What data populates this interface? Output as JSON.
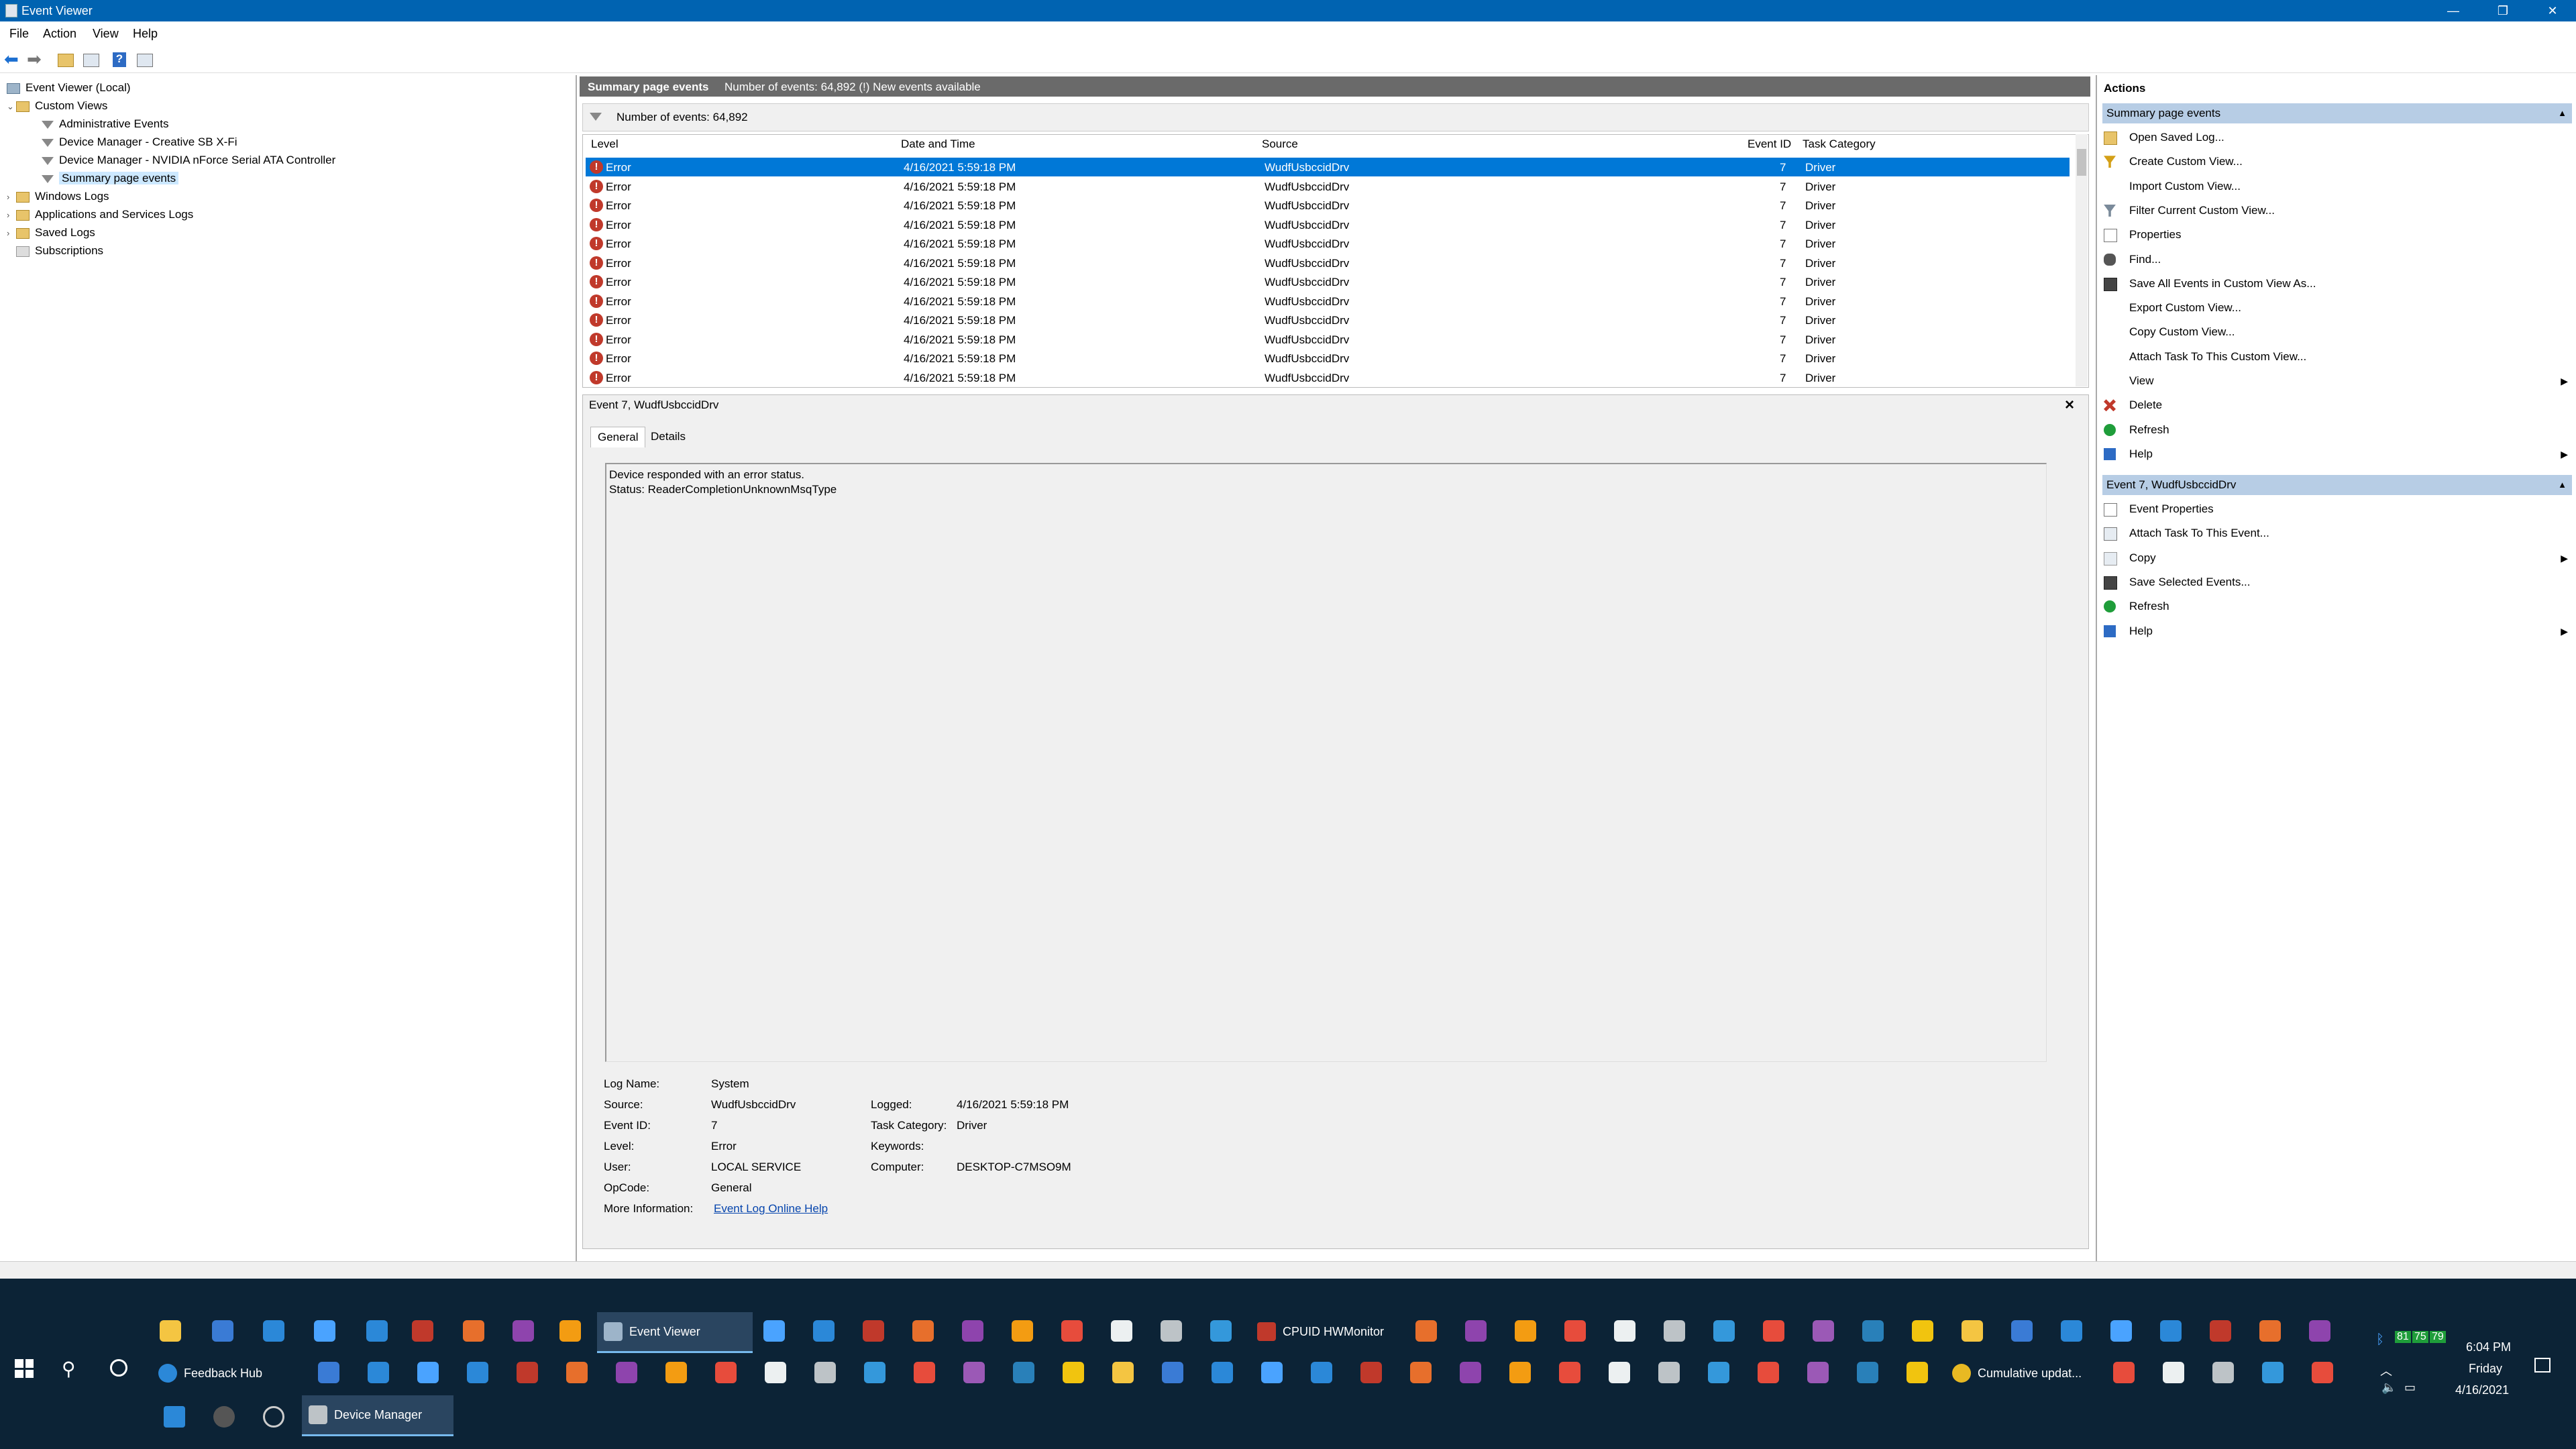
{
  "window": {
    "title": "Event Viewer",
    "minimize": "—",
    "restore": "❐",
    "close": "✕"
  },
  "menu": [
    "File",
    "Action",
    "View",
    "Help"
  ],
  "tree": {
    "root": "Event Viewer (Local)",
    "custom_views": "Custom Views",
    "custom_items": [
      "Administrative Events",
      "Device Manager - Creative SB X-Fi",
      "Device Manager - NVIDIA nForce Serial ATA Controller",
      "Summary page events"
    ],
    "windows_logs": "Windows Logs",
    "app_services": "Applications and Services Logs",
    "saved_logs": "Saved Logs",
    "subscriptions": "Subscriptions"
  },
  "middle": {
    "header_title": "Summary page events",
    "header_info": "Number of events: 64,892 (!) New events available",
    "count": "Number of events: 64,892",
    "columns": [
      "Level",
      "Date and Time",
      "Source",
      "Event ID",
      "Task Category"
    ],
    "rows": [
      {
        "level": "Error",
        "date": "4/16/2021 5:59:18 PM",
        "source": "WudfUsbccidDrv",
        "id": "7",
        "cat": "Driver"
      },
      {
        "level": "Error",
        "date": "4/16/2021 5:59:18 PM",
        "source": "WudfUsbccidDrv",
        "id": "7",
        "cat": "Driver"
      },
      {
        "level": "Error",
        "date": "4/16/2021 5:59:18 PM",
        "source": "WudfUsbccidDrv",
        "id": "7",
        "cat": "Driver"
      },
      {
        "level": "Error",
        "date": "4/16/2021 5:59:18 PM",
        "source": "WudfUsbccidDrv",
        "id": "7",
        "cat": "Driver"
      },
      {
        "level": "Error",
        "date": "4/16/2021 5:59:18 PM",
        "source": "WudfUsbccidDrv",
        "id": "7",
        "cat": "Driver"
      },
      {
        "level": "Error",
        "date": "4/16/2021 5:59:18 PM",
        "source": "WudfUsbccidDrv",
        "id": "7",
        "cat": "Driver"
      },
      {
        "level": "Error",
        "date": "4/16/2021 5:59:18 PM",
        "source": "WudfUsbccidDrv",
        "id": "7",
        "cat": "Driver"
      },
      {
        "level": "Error",
        "date": "4/16/2021 5:59:18 PM",
        "source": "WudfUsbccidDrv",
        "id": "7",
        "cat": "Driver"
      },
      {
        "level": "Error",
        "date": "4/16/2021 5:59:18 PM",
        "source": "WudfUsbccidDrv",
        "id": "7",
        "cat": "Driver"
      },
      {
        "level": "Error",
        "date": "4/16/2021 5:59:18 PM",
        "source": "WudfUsbccidDrv",
        "id": "7",
        "cat": "Driver"
      },
      {
        "level": "Error",
        "date": "4/16/2021 5:59:18 PM",
        "source": "WudfUsbccidDrv",
        "id": "7",
        "cat": "Driver"
      },
      {
        "level": "Error",
        "date": "4/16/2021 5:59:18 PM",
        "source": "WudfUsbccidDrv",
        "id": "7",
        "cat": "Driver"
      }
    ]
  },
  "detail": {
    "title": "Event 7, WudfUsbccidDrv",
    "tabs": [
      "General",
      "Details"
    ],
    "message_line1": "Device responded with an error status.",
    "message_line2": "Status: ReaderCompletionUnknownMsqType",
    "fields": {
      "log_name_label": "Log Name:",
      "log_name": "System",
      "source_label": "Source:",
      "source": "WudfUsbccidDrv",
      "event_id_label": "Event ID:",
      "event_id": "7",
      "level_label": "Level:",
      "level": "Error",
      "user_label": "User:",
      "user": "LOCAL SERVICE",
      "opcode_label": "OpCode:",
      "opcode": "General",
      "more_info_label": "More Information:",
      "more_info": "Event Log Online Help",
      "logged_label": "Logged:",
      "logged": "4/16/2021 5:59:18 PM",
      "task_cat_label": "Task Category:",
      "task_cat": "Driver",
      "keywords_label": "Keywords:",
      "keywords": "",
      "computer_label": "Computer:",
      "computer": "DESKTOP-C7MSO9M"
    }
  },
  "actions": {
    "title": "Actions",
    "section1": "Summary page events",
    "items1": [
      {
        "label": "Open Saved Log...",
        "icon": "folder-open-icon"
      },
      {
        "label": "Create Custom View...",
        "icon": "filter-star-icon"
      },
      {
        "label": "Import Custom View...",
        "icon": "blank-icon"
      },
      {
        "label": "Filter Current Custom View...",
        "icon": "filter-icon"
      },
      {
        "label": "Properties",
        "icon": "properties-icon"
      },
      {
        "label": "Find...",
        "icon": "binoculars-icon"
      },
      {
        "label": "Save All Events in Custom View As...",
        "icon": "save-icon"
      },
      {
        "label": "Export Custom View...",
        "icon": "blank-icon"
      },
      {
        "label": "Copy Custom View...",
        "icon": "blank-icon"
      },
      {
        "label": "Attach Task To This Custom View...",
        "icon": "blank-icon"
      },
      {
        "label": "View",
        "icon": "blank-icon",
        "submenu": true
      },
      {
        "label": "Delete",
        "icon": "delete-icon"
      },
      {
        "label": "Refresh",
        "icon": "refresh-icon"
      },
      {
        "label": "Help",
        "icon": "help-icon",
        "submenu": true
      }
    ],
    "section2": "Event 7, WudfUsbccidDrv",
    "items2": [
      {
        "label": "Event Properties",
        "icon": "properties-icon"
      },
      {
        "label": "Attach Task To This Event...",
        "icon": "task-icon"
      },
      {
        "label": "Copy",
        "icon": "copy-icon",
        "submenu": true
      },
      {
        "label": "Save Selected Events...",
        "icon": "save-icon"
      },
      {
        "label": "Refresh",
        "icon": "refresh-icon"
      },
      {
        "label": "Help",
        "icon": "help-icon",
        "submenu": true
      }
    ]
  },
  "taskbar": {
    "event_viewer": "Event Viewer",
    "hwmonitor": "CPUID HWMonitor",
    "feedback_hub": "Feedback Hub",
    "cumulative": "Cumulative updat...",
    "device_manager": "Device Manager",
    "time": "6:04 PM",
    "day": "Friday",
    "date": "4/16/2021",
    "temp1": "81",
    "temp2": "75",
    "temp3": "79"
  },
  "colors": {
    "accent": "#0078d7",
    "titlebar": "#0063b1",
    "taskbar": "#0c2336",
    "error": "#c0392b",
    "section": "#b7cde5"
  }
}
